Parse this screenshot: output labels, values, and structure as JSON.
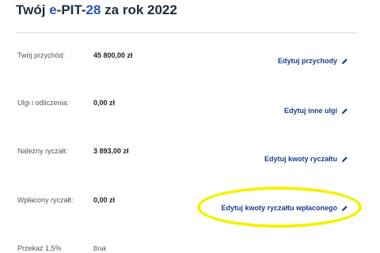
{
  "header": {
    "title_prefix": "Twój ",
    "title_e": "e",
    "title_dash": "-PIT-",
    "title_number": "28",
    "title_suffix": " za rok 2022"
  },
  "rows": [
    {
      "label": "Twój przychód:",
      "value": "45 800,00 zł",
      "edit_label": "Edytuj przychody"
    },
    {
      "label": "Ulgi i odliczenia:",
      "value": "0,00 zł",
      "edit_label": "Edytuj inne ulgi"
    },
    {
      "label": "Należny ryczałt:",
      "value": "3 893,00 zł",
      "edit_label": "Edytuj kwoty ryczałtu"
    },
    {
      "label": "Wpłacony ryczałt:",
      "value": "0,00 zł",
      "edit_label": "Edytuj kwoty ryczałtu wpłaconego"
    },
    {
      "label": "Przekaż 1,5%",
      "value": "Brak"
    }
  ],
  "colors": {
    "accent": "#2a58b5",
    "link": "#1a3d8f",
    "highlight": "#f4f100"
  },
  "icons": {
    "edit": "pencil-icon"
  }
}
